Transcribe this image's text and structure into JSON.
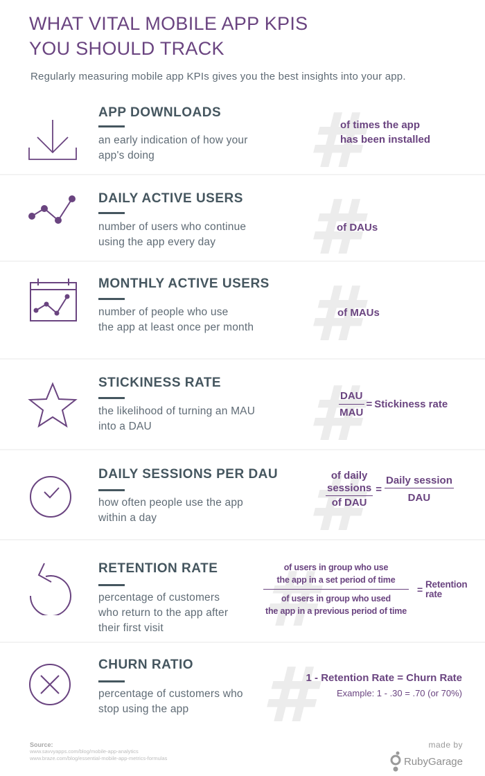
{
  "header": {
    "title_line1": "WHAT VITAL MOBILE APP KPIS",
    "title_line2": "YOU SHOULD TRACK",
    "subtitle": "Regularly measuring mobile app KPIs gives you the best insights into your app."
  },
  "colors": {
    "accent": "#6a4480",
    "heading": "#45565f",
    "body": "#5f6b75",
    "hash": "#ececec",
    "divider": "#f3f3f3"
  },
  "kpis": [
    {
      "icon": "download-icon",
      "title": "APP DOWNLOADS",
      "desc_line1": "an early indication of how your",
      "desc_line2": "app's doing",
      "metric_line1": "of times the app",
      "metric_line2": "has been installed"
    },
    {
      "icon": "line-chart-icon",
      "title": "DAILY ACTIVE USERS",
      "desc_line1": "number of users who continue",
      "desc_line2": "using the app every day",
      "metric_line1": "of DAUs"
    },
    {
      "icon": "calendar-chart-icon",
      "title": "MONTHLY ACTIVE USERS",
      "desc_line1": "number of people who use",
      "desc_line2": "the app at least once per month",
      "metric_line1": "of MAUs"
    },
    {
      "icon": "star-icon",
      "title": "STICKINESS RATE",
      "desc_line1": "the likelihood of turning an MAU",
      "desc_line2": "into a DAU",
      "formula": {
        "numerator": "DAU",
        "denominator": "MAU",
        "equals": "=",
        "result": "Stickiness rate"
      }
    },
    {
      "icon": "check-circle-icon",
      "title": "DAILY SESSIONS PER DAU",
      "desc_line1": "how often people use the app",
      "desc_line2": "within a day",
      "formula": {
        "numerator_line1": "of daily",
        "numerator_line2": "sessions",
        "denominator": "of DAU",
        "equals": "=",
        "rhs_numerator": "Daily session",
        "rhs_denominator": "DAU"
      }
    },
    {
      "icon": "undo-arrow-icon",
      "title": "RETENTION RATE",
      "desc_line1": "percentage of customers",
      "desc_line2": "who return to the app after",
      "desc_line3": "their first visit",
      "formula": {
        "numerator_line1": "of users in group who use",
        "numerator_line2": "the app in a set period of time",
        "denominator_line1": "of users in group who used",
        "denominator_line2": "the app in a previous period of time",
        "equals": "=",
        "result_line1": "Retention",
        "result_line2": "rate"
      }
    },
    {
      "icon": "x-circle-icon",
      "title": "CHURN RATIO",
      "desc_line1": "percentage of customers who",
      "desc_line2": "stop using the app",
      "formula": {
        "main": "1 - Retention Rate = Churn Rate",
        "example": "Example: 1 - .30 = .70 (or 70%)"
      }
    }
  ],
  "footer": {
    "source_label": "Source:",
    "sources": [
      "www.savvyapps.com/blog/mobile-app-analytics",
      "www.braze.com/blog/essential-mobile-app-metrics-formulas"
    ],
    "made_by": "made by",
    "brand": "RubyGarage"
  }
}
